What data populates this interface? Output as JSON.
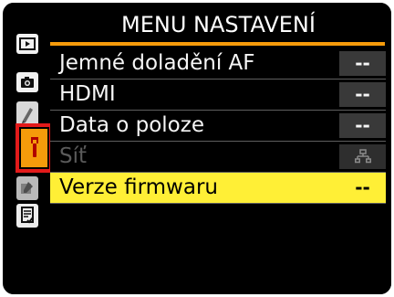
{
  "header": {
    "title": "MENU NASTAVENÍ"
  },
  "sidebar": {
    "items": [
      {
        "name": "playback-icon"
      },
      {
        "name": "camera-icon"
      },
      {
        "name": "pencil-icon"
      },
      {
        "name": "wrench-icon",
        "active": true
      },
      {
        "name": "retouch-icon"
      },
      {
        "name": "my-menu-icon"
      }
    ]
  },
  "menu": {
    "items": [
      {
        "label": "Jemné doladění AF",
        "value": "--"
      },
      {
        "label": "HDMI",
        "value": "--"
      },
      {
        "label": "Data o poloze",
        "value": "--"
      },
      {
        "label": "Síť",
        "value_icon": "network-icon",
        "disabled": true
      },
      {
        "label": "Verze firmwaru",
        "value": "--",
        "selected": true
      }
    ]
  },
  "colors": {
    "accent": "#f59b0b",
    "highlight": "#ffef36",
    "selection_border": "#e31a1a"
  }
}
